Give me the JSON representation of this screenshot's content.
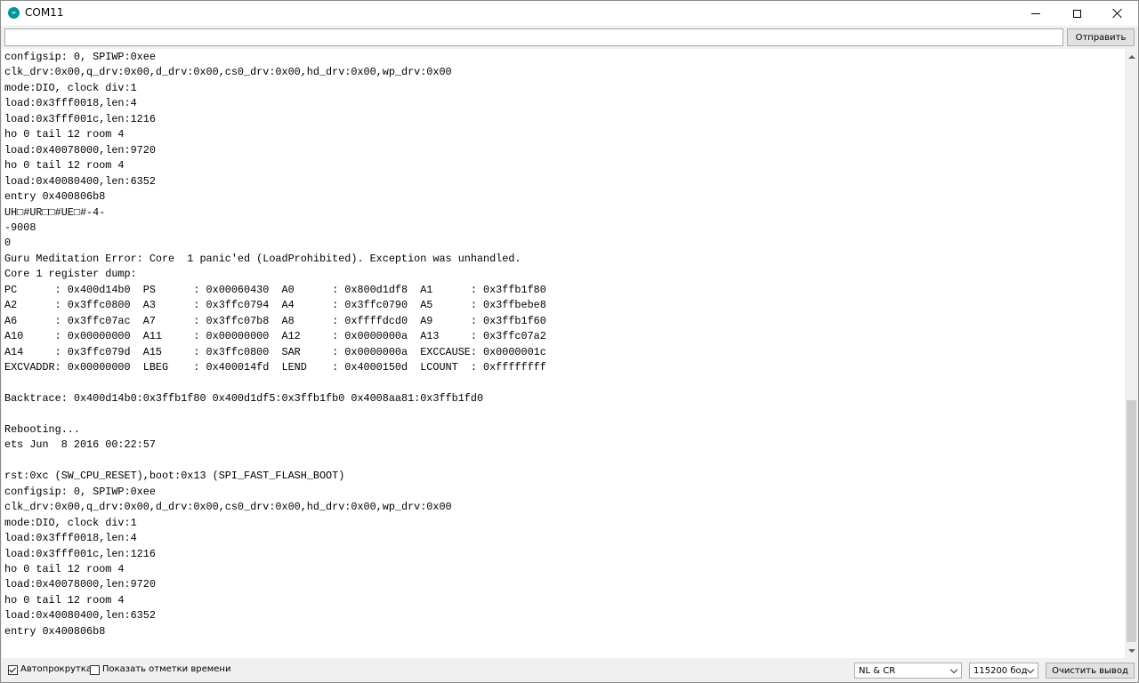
{
  "window": {
    "title": "COM11",
    "icon": "arduino-icon",
    "icon_text": "∞"
  },
  "toolbar": {
    "input_value": "",
    "send_label": "Отправить"
  },
  "serial_output": {
    "lines": [
      "configsip: 0, SPIWP:0xee",
      "clk_drv:0x00,q_drv:0x00,d_drv:0x00,cs0_drv:0x00,hd_drv:0x00,wp_drv:0x00",
      "mode:DIO, clock div:1",
      "load:0x3fff0018,len:4",
      "load:0x3fff001c,len:1216",
      "ho 0 tail 12 room 4",
      "load:0x40078000,len:9720",
      "ho 0 tail 12 room 4",
      "load:0x40080400,len:6352",
      "entry 0x400806b8",
      "UH□#UR□□#UE□#-4-",
      "-9008",
      "0",
      "Guru Meditation Error: Core  1 panic'ed (LoadProhibited). Exception was unhandled.",
      "Core 1 register dump:",
      "PC      : 0x400d14b0  PS      : 0x00060430  A0      : 0x800d1df8  A1      : 0x3ffb1f80",
      "A2      : 0x3ffc0800  A3      : 0x3ffc0794  A4      : 0x3ffc0790  A5      : 0x3ffbebe8",
      "A6      : 0x3ffc07ac  A7      : 0x3ffc07b8  A8      : 0xffffdcd0  A9      : 0x3ffb1f60",
      "A10     : 0x00000000  A11     : 0x00000000  A12     : 0x0000000a  A13     : 0x3ffc07a2",
      "A14     : 0x3ffc079d  A15     : 0x3ffc0800  SAR     : 0x0000000a  EXCCAUSE: 0x0000001c",
      "EXCVADDR: 0x00000000  LBEG    : 0x400014fd  LEND    : 0x4000150d  LCOUNT  : 0xffffffff",
      "",
      "Backtrace: 0x400d14b0:0x3ffb1f80 0x400d1df5:0x3ffb1fb0 0x4008aa81:0x3ffb1fd0",
      "",
      "Rebooting...",
      "ets Jun  8 2016 00:22:57",
      "",
      "rst:0xc (SW_CPU_RESET),boot:0x13 (SPI_FAST_FLASH_BOOT)",
      "configsip: 0, SPIWP:0xee",
      "clk_drv:0x00,q_drv:0x00,d_drv:0x00,cs0_drv:0x00,hd_drv:0x00,wp_drv:0x00",
      "mode:DIO, clock div:1",
      "load:0x3fff0018,len:4",
      "load:0x3fff001c,len:1216",
      "ho 0 tail 12 room 4",
      "load:0x40078000,len:9720",
      "ho 0 tail 12 room 4",
      "load:0x40080400,len:6352",
      "entry 0x400806b8"
    ]
  },
  "footer": {
    "autoscroll_label": "Автопрокрутка",
    "autoscroll_checked": true,
    "timestamps_label": "Показать отметки времени",
    "timestamps_checked": false,
    "line_ending_value": "NL & CR",
    "baud_value": "115200 бод",
    "clear_label": "Очистить вывод"
  },
  "colors": {
    "chrome": "#f0f0f0",
    "output_bg": "#ffffff",
    "text": "#000000",
    "arduino_teal": "#00979c"
  }
}
